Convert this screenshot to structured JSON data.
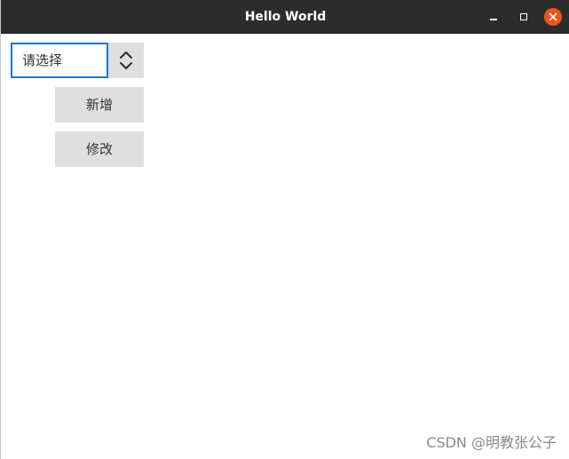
{
  "window": {
    "title": "Hello World"
  },
  "titlebar_icons": [
    "minimize-icon",
    "maximize-icon",
    "close-icon"
  ],
  "colors": {
    "titlebar_bg": "#2c2c2c",
    "close_button": "#e95420",
    "focus_border": "#1f72d4",
    "button_bg": "#dfdfdf"
  },
  "combo": {
    "value": "请选择",
    "arrow_icon": "updown-chevron-icon"
  },
  "buttons": {
    "add_label": "新增",
    "edit_label": "修改"
  },
  "watermark": "CSDN @明教张公子"
}
